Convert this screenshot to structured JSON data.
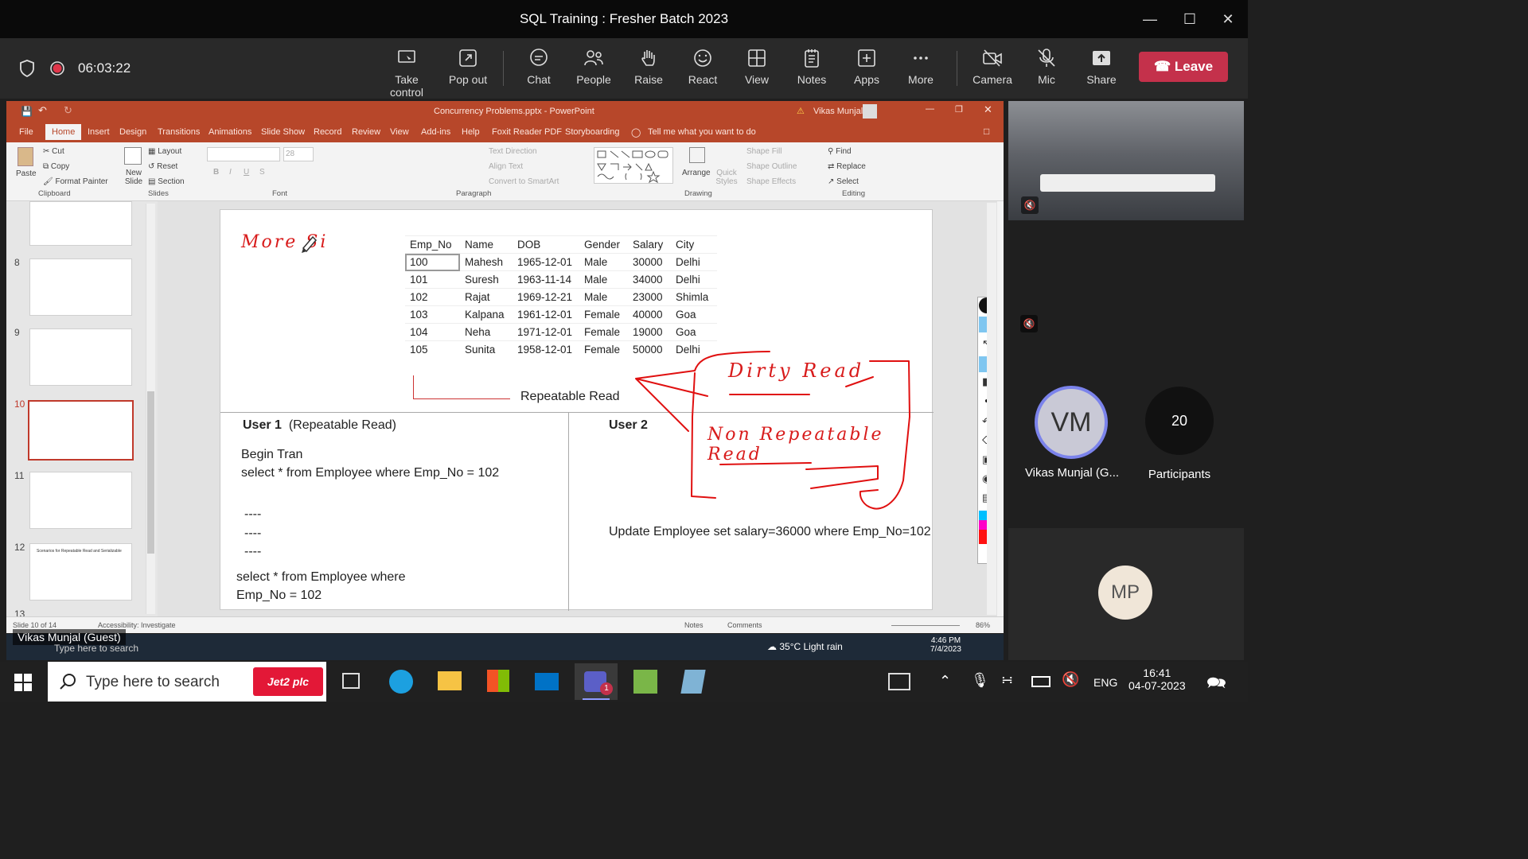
{
  "window": {
    "title": "SQL Training : Fresher Batch 2023"
  },
  "meeting": {
    "timer": "06:03:22",
    "buttons": [
      "Take control",
      "Pop out",
      "Chat",
      "People",
      "Raise",
      "React",
      "View",
      "Notes",
      "Apps",
      "More",
      "Camera",
      "Mic",
      "Share"
    ],
    "leave_label": "Leave"
  },
  "ppt": {
    "title": "Concurrency Problems.pptx - PowerPoint",
    "user": "Vikas Munjal",
    "tabs": [
      "File",
      "Home",
      "Insert",
      "Design",
      "Transitions",
      "Animations",
      "Slide Show",
      "Record",
      "Review",
      "View",
      "Add-ins",
      "Help",
      "Foxit Reader PDF",
      "Storyboarding"
    ],
    "tell_me": "Tell me what you want to do",
    "ribbon": {
      "paste": "Paste",
      "cut": "Cut",
      "copy": "Copy",
      "format_painter": "Format Painter",
      "clipboard": "Clipboard",
      "new_slide": "New Slide",
      "layout": "Layout",
      "reset": "Reset",
      "section": "Section",
      "slides": "Slides",
      "font_size": "28",
      "font": "Font",
      "text_direction": "Text Direction",
      "align_text": "Align Text",
      "convert_smartart": "Convert to SmartArt",
      "paragraph": "Paragraph",
      "arrange": "Arrange",
      "quick_styles": "Quick Styles",
      "shape_fill": "Shape Fill",
      "shape_outline": "Shape Outline",
      "shape_effects": "Shape Effects",
      "drawing": "Drawing",
      "find": "Find",
      "replace": "Replace",
      "select": "Select",
      "editing": "Editing"
    },
    "thumbnails": [
      {
        "num": "8"
      },
      {
        "num": "9"
      },
      {
        "num": "10"
      },
      {
        "num": "11"
      },
      {
        "num": "12",
        "text": "Scenarios for Repeatable Read and Serializable"
      },
      {
        "num": "13"
      }
    ],
    "status": {
      "slide": "Slide 10 of 14",
      "accessibility": "Accessibility: Investigate",
      "notes": "Notes",
      "comments": "Comments",
      "zoom": "86%"
    }
  },
  "slide": {
    "ink_top": "More Si",
    "table": {
      "headers": [
        "Emp_No",
        "Name",
        "DOB",
        "Gender",
        "Salary",
        "City"
      ],
      "rows": [
        [
          "100",
          "Mahesh",
          "1965-12-01",
          "Male",
          "30000",
          "Delhi"
        ],
        [
          "101",
          "Suresh",
          "1963-11-14",
          "Male",
          "34000",
          "Delhi"
        ],
        [
          "102",
          "Rajat",
          "1969-12-21",
          "Male",
          "23000",
          "Shimla"
        ],
        [
          "103",
          "Kalpana",
          "1961-12-01",
          "Female",
          "40000",
          "Goa"
        ],
        [
          "104",
          "Neha",
          "1971-12-01",
          "Female",
          "19000",
          "Goa"
        ],
        [
          "105",
          "Sunita",
          "1958-12-01",
          "Female",
          "50000",
          "Delhi"
        ]
      ]
    },
    "heading": "Repeatable Read",
    "user1_title": "User 1",
    "user1_mode": "(Repeatable Read)",
    "user1_begin": "Begin Tran",
    "user1_select": "select * from Employee where Emp_No = 102",
    "dashes": [
      "----",
      "----",
      "----"
    ],
    "user1_select2a": "select * from Employee where",
    "user1_select2b": "Emp_No = 102",
    "user2_title": "User 2",
    "user2_update": "Update Employee set salary=36000 where Emp_No=102",
    "ink_dirty": "Dirty Read",
    "ink_nonrep": "Non Repeatable Read"
  },
  "participants": {
    "vm_initials": "VM",
    "vm_name": "Vikas Munjal (G...",
    "count": "20",
    "count_label": "Participants",
    "mp_initials": "MP",
    "presenter_label": "Vikas Munjal (Guest)"
  },
  "inner_taskbar": {
    "search": "Type here to search",
    "weather": "35°C  Light rain",
    "time": "4:46 PM",
    "date": "7/4/2023"
  },
  "taskbar": {
    "search": "Type here to search",
    "pinned": "Jet2 plc",
    "lang": "ENG",
    "time": "16:41",
    "date": "04-07-2023"
  }
}
